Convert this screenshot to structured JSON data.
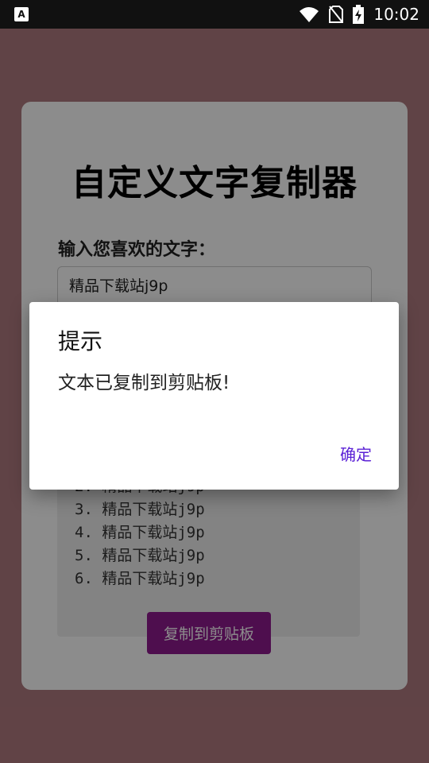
{
  "status_bar": {
    "time": "10:02",
    "icons": [
      "app-notification-icon",
      "wifi-icon",
      "no-sim-icon",
      "battery-charging-icon"
    ]
  },
  "app": {
    "title": "自定义文字复制器",
    "input_label": "输入您喜欢的文字：",
    "input_value": "精品下载站j9p",
    "output_lines": [
      "2. 精品下载站j9p",
      "3. 精品下载站j9p",
      "4. 精品下载站j9p",
      "5. 精品下载站j9p",
      "6. 精品下载站j9p"
    ],
    "copy_button_label": "复制到剪贴板"
  },
  "dialog": {
    "title": "提示",
    "message": "文本已复制到剪贴板!",
    "ok_label": "确定"
  },
  "colors": {
    "page_background": "#b07a80",
    "button": "#8e1a8e",
    "dialog_action": "#5b21d6"
  }
}
